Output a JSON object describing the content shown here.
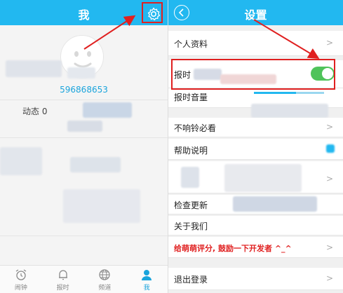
{
  "left_screen": {
    "header_title": "我",
    "user_id_partial": "596868653",
    "dynamic_label": "动态 0",
    "nav": [
      {
        "label": "闹钟",
        "icon": "alarm-clock-icon",
        "active": false
      },
      {
        "label": "报时",
        "icon": "bell-icon",
        "active": false
      },
      {
        "label": "频道",
        "icon": "globe-icon",
        "active": false
      },
      {
        "label": "我",
        "icon": "person-icon",
        "active": true
      }
    ]
  },
  "right_screen": {
    "header_title": "设置",
    "items": [
      {
        "label": "个人资料"
      },
      {
        "label": "报时"
      },
      {
        "label": "报时音量"
      },
      {
        "label": "不响铃必看"
      },
      {
        "label": "帮助说明"
      },
      {
        "label": "检查更新"
      },
      {
        "label": "关于我们"
      },
      {
        "label": "给萌萌评分, 鼓励一下开发者 ^_^"
      },
      {
        "label": "退出登录"
      }
    ],
    "toggle_on": true,
    "volume_level": 0.6,
    "chevron": ">"
  },
  "colors": {
    "header": "#22b8f0",
    "accent_blue": "#1aa4dc",
    "toggle_green": "#4fc35a",
    "annotation_red": "#e02020"
  }
}
